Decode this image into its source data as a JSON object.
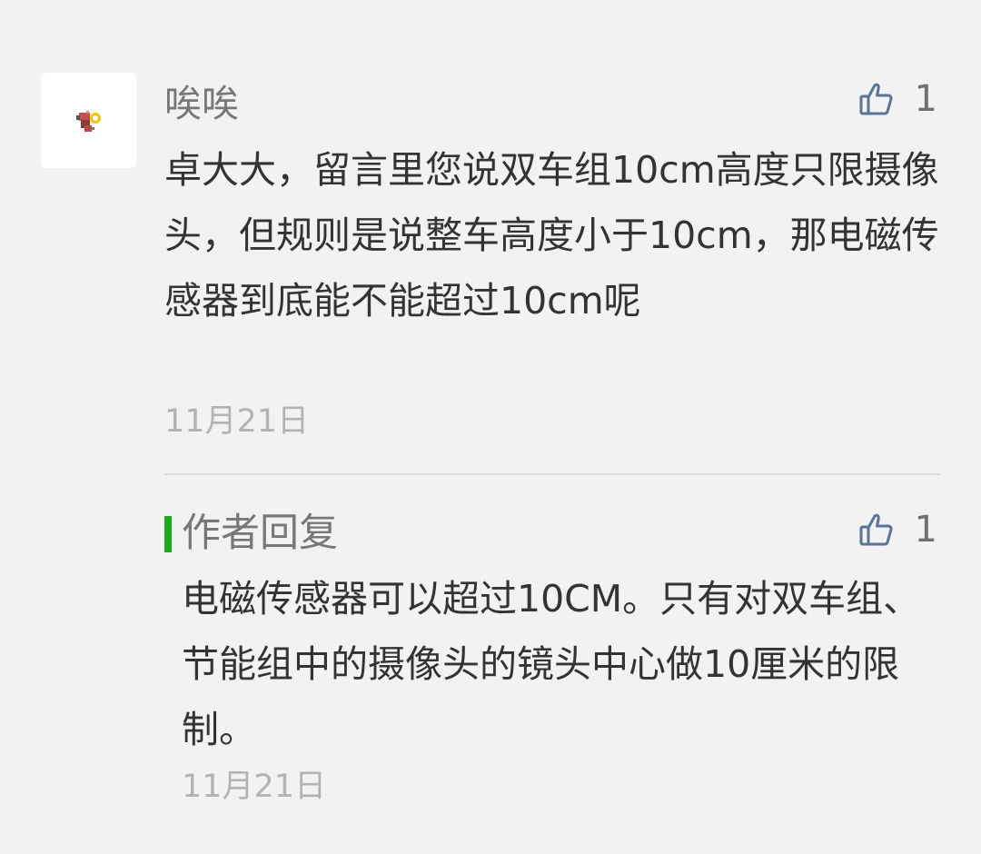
{
  "comment": {
    "nickname": "唉唉",
    "text": "卓大大，留言里您说双车组10cm高度只限摄像头，但规则是说整车高度小于10cm，那电磁传感器到底能不能超过10cm呢",
    "date": "11月21日",
    "likes": "1",
    "like_icon": "thumbs-up-icon"
  },
  "reply": {
    "label": "作者回复",
    "text": "电磁传感器可以超过10CM。只有对双车组、节能组中的摄像头的镜头中心做10厘米的限制。",
    "date": "11月21日",
    "likes": "1",
    "like_icon": "thumbs-up-icon"
  },
  "colors": {
    "background": "#f2f2f2",
    "accent_green": "#1aad19",
    "like_icon_blue": "#5b7397"
  }
}
